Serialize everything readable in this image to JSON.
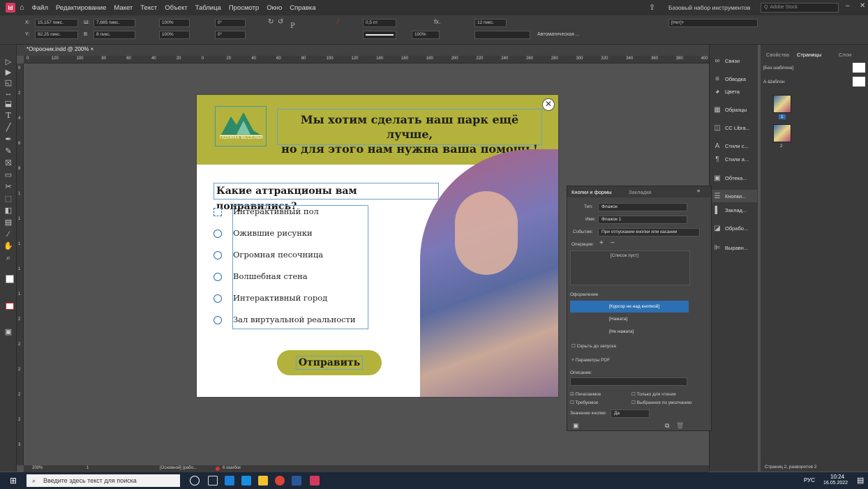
{
  "menubar": {
    "app_icon": "Id",
    "items": [
      "Файл",
      "Редактирование",
      "Макет",
      "Текст",
      "Объект",
      "Таблица",
      "Просмотр",
      "Окно",
      "Справка"
    ],
    "workspace": "Базовый набор инструментов",
    "search_placeholder": "Adobe Stock"
  },
  "control": {
    "x_label": "X:",
    "x_value": "15,157 пикс.",
    "y_label": "Y:",
    "y_value": "92,25 пикс.",
    "w_label": "Ш:",
    "w_value": "7,685 пикс.",
    "h_label": "В:",
    "h_value": "8 пикс.",
    "scale_x": "100%",
    "scale_y": "100%",
    "angle": "0°",
    "shear": "0°",
    "stroke_weight": "0,5 пт",
    "opacity": "100%",
    "corner": "12 пикс.",
    "autofit": "Автоматическая ...",
    "style": "[Нет]+"
  },
  "document": {
    "tab_title": "*Опросник.indd @ 200%",
    "zoom": "200%",
    "page_number": "1",
    "base_state": "[Основной] (рабо...",
    "errors": "6 ошибок"
  },
  "hruler_ticks": [
    "0",
    "120",
    "100",
    "80",
    "60",
    "40",
    "20",
    "0",
    "20",
    "40",
    "60",
    "80",
    "100",
    "120",
    "140",
    "160",
    "180",
    "200",
    "220",
    "240",
    "260",
    "280",
    "300",
    "320",
    "340",
    "360",
    "380",
    "400"
  ],
  "vruler_ticks": [
    "0",
    "2",
    "4",
    "6",
    "8",
    "1",
    "1",
    "1",
    "1",
    "1",
    "2",
    "2",
    "2",
    "2",
    "2",
    "3"
  ],
  "page": {
    "logo_text": "ПОЛЯНА ВЕСЕЛЬЯ",
    "heading_line1": "Мы хотим сделать наш парк ещё лучше,",
    "heading_line2": "но для этого нам нужна ваша помощь!",
    "question": "Какие аттракционы вам понравились?",
    "options": [
      "Интерактивный пол",
      "Ожившие рисунки",
      "Огромная песочница",
      "Волшебная стена",
      "Интерактивный город",
      "Зал виртуальной реальности"
    ],
    "submit": "Отправить",
    "close_glyph": "✕"
  },
  "panel_strip": {
    "items": [
      "Связи",
      "Обводка",
      "Цвета",
      "Образцы",
      "CC Libra...",
      "Стили с...",
      "Стили а...",
      "Обтека...",
      "Кнопки...",
      "Заклад...",
      "Обрабо...",
      "Выравн..."
    ]
  },
  "pages_panel": {
    "tabs": [
      "Свойства",
      "Страницы",
      "Слои"
    ],
    "masters": [
      "[Без шаблона]",
      "А-Шаблон"
    ],
    "page_labels": [
      "1",
      "2"
    ],
    "footer": "Страниц 2, разворотов 2"
  },
  "buttons_panel": {
    "tab_active": "Кнопки и формы",
    "tab_other": "Закладки",
    "type_label": "Тип:",
    "type_value": "Флажок",
    "name_label": "Имя:",
    "name_value": "Флажок 1",
    "event_label": "Событие:",
    "event_value": "При отпускании кнопки или касании",
    "actions_label": "Операции:",
    "actions_empty": "[Список пуст]",
    "appearance_label": "Оформление",
    "states": [
      "[Курсор не над кнопкой]",
      "[Нажата]",
      "[Не нажата]"
    ],
    "hide_until": "Скрыть до запуска",
    "pdf_options": "Параметры PDF",
    "description_label": "Описание:",
    "printable": "Печатаемое",
    "readonly": "Только для чтения",
    "required": "Требуемое",
    "default_selected": "Выбранное по умолчанию",
    "button_value_label": "Значение кнопки:",
    "button_value": "Да"
  },
  "taskbar": {
    "search_placeholder": "Введите здесь текст для поиска",
    "lang": "РУС",
    "time": "10:24",
    "date": "16.05.2022"
  }
}
